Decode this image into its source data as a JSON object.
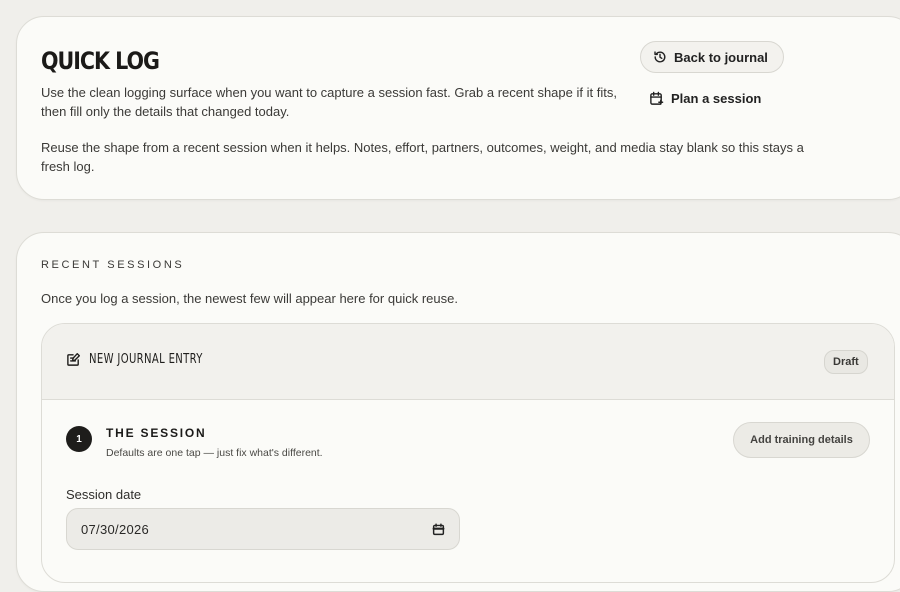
{
  "header": {
    "title": "QUICK LOG",
    "intro": "Use the clean logging surface when you want to capture a session fast. Grab a recent shape if it fits, then fill only the details that changed today.",
    "note": "Reuse the shape from a recent session when it helps. Notes, effort, partners, outcomes, weight, and media stay blank so this stays a fresh log.",
    "back_label": "Back to journal",
    "plan_label": "Plan a session"
  },
  "recent": {
    "kicker": "RECENT SESSIONS",
    "description": "Once you log a session, the newest few will appear here for quick reuse."
  },
  "entry": {
    "title": "NEW JOURNAL ENTRY",
    "status": "Draft",
    "step": {
      "number": "1",
      "title": "THE SESSION",
      "subtitle": "Defaults are one tap — just fix what's different.",
      "action_label": "Add training details"
    },
    "date_field": {
      "label": "Session date",
      "value": "07/30/2026"
    }
  },
  "icons": {
    "back": "history-icon",
    "plan": "calendar-plus-icon",
    "entry": "edit-note-icon",
    "date": "calendar-icon"
  }
}
